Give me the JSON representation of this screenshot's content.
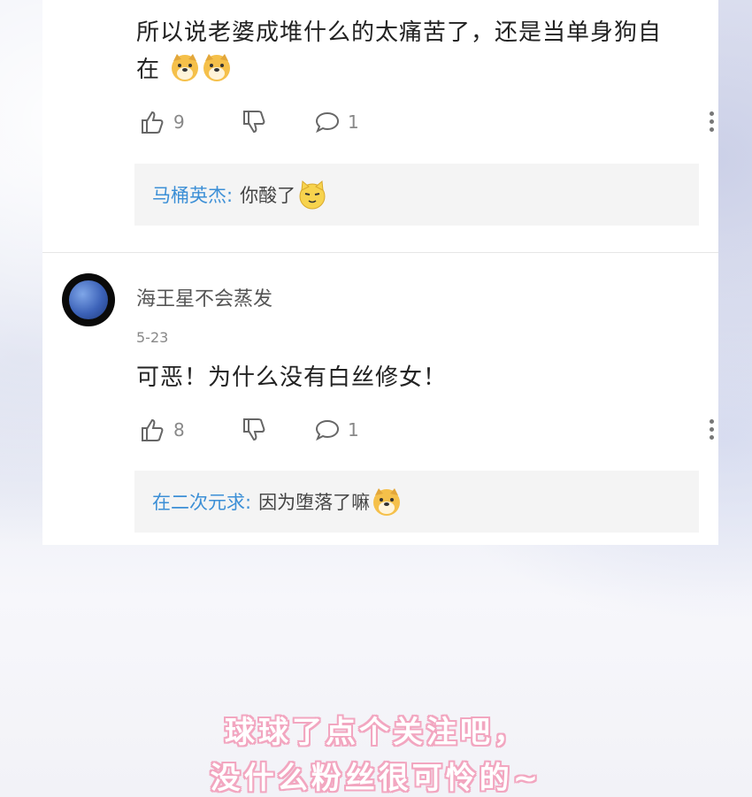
{
  "comments": [
    {
      "text_line1": "所以说老婆成堆什么的太痛苦了，还是当单身狗自",
      "text_line2": "在",
      "likes": "9",
      "replies": "1",
      "reply": {
        "user": "马桶英杰:",
        "text": "你酸了"
      }
    },
    {
      "username": "海王星不会蒸发",
      "date": "5-23",
      "text": "可恶！为什么没有白丝修女！",
      "likes": "8",
      "replies": "1",
      "reply": {
        "user": "在二次元求:",
        "text": "因为堕落了嘛"
      }
    }
  ],
  "footer": {
    "line1": "球球了点个关注吧，",
    "line2": "没什么粉丝很可怜的~"
  },
  "icons": [
    "thumbs-up-icon",
    "thumbs-down-icon",
    "comment-icon",
    "more-vertical-icon",
    "doge-emoji-icon",
    "cat-emoji-icon",
    "neptune-avatar"
  ],
  "colors": {
    "reply_user": "#3c8fd6",
    "footer_outline": "#f2a6c0"
  }
}
